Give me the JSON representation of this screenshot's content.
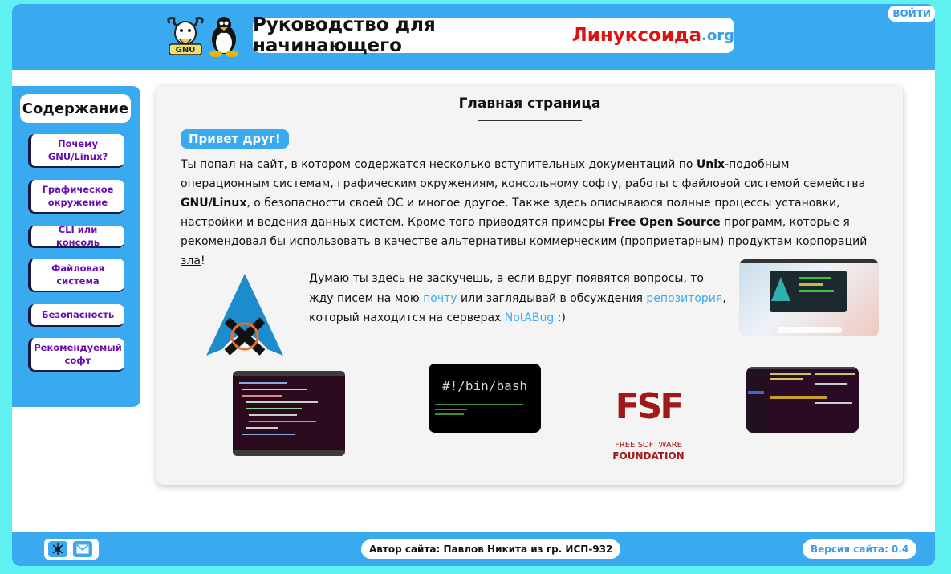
{
  "header": {
    "login_label": "ВОЙТИ",
    "title_main": "Руководство для начинающего",
    "title_accent": "Линуксоида",
    "title_domain": ".org",
    "accent_color": "#e01010",
    "brand_color": "#3aaaf0"
  },
  "sidebar": {
    "title": "Содержание",
    "items": [
      {
        "label": "Почему GNU/Linux?"
      },
      {
        "label": "Графическое окружение"
      },
      {
        "label": "CLI или консоль"
      },
      {
        "label": "Файловая система"
      },
      {
        "label": "Безопасность"
      },
      {
        "label": "Рекомендуемый софт"
      }
    ]
  },
  "main": {
    "page_title": "Главная страница",
    "greeting": "Привет друг!",
    "intro": {
      "p1": "Ты попал на сайт, в котором содержатся несколько вступительных документаций по ",
      "b1": "Unix",
      "p2": "-подобным операционным системам, графическим окружениям, консольному софту, работы с файловой системой семейства ",
      "b2": "GNU/Linux",
      "p3": ", о безопасности своей ОС и многое другое. Также здесь описываюся полные процессы установки, настройки и ведения данных систем. Кроме того приводятся примеры ",
      "b3": "Free Open Source",
      "p4": " программ, которые я рекомендовал бы использовать в качестве альтернативы коммерческим (проприетарным) продуктам корпораций ",
      "evil": "зла",
      "end": "!"
    },
    "second": {
      "p1": "Думаю ты здесь не заскучешь, а если вдруг появятся вопросы, то жду писем на мою ",
      "link_mail": "почту",
      "p2": " или заглядывай в обсуждения ",
      "link_repo": "репозитория",
      "p3": ", который находится на серверах ",
      "link_host": "NotABug",
      "p4": " :)"
    },
    "images": {
      "bash_text": "#!/bin/bash",
      "fsf_big": "FSF",
      "fsf_line1": "FREE SOFTWARE",
      "fsf_line2": "FOUNDATION",
      "gnu_label": "GNU"
    }
  },
  "footer": {
    "author": "Автор сайта: Павлов Никита из гр. ИСП-932",
    "version": "Версия сайта: 0.4"
  }
}
